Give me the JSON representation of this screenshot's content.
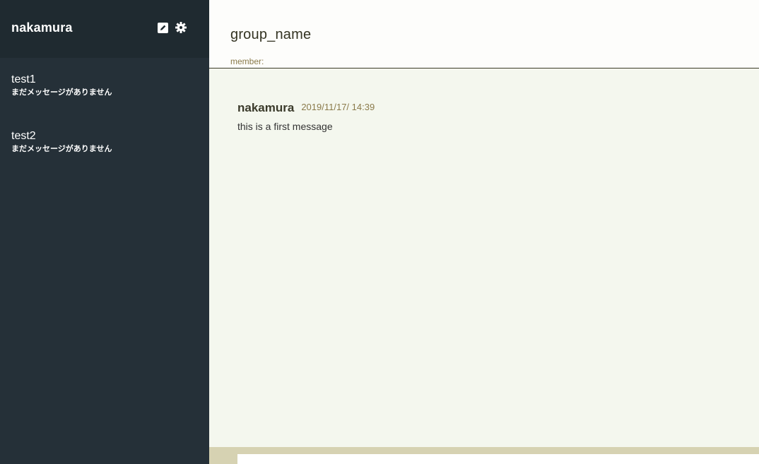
{
  "sidebar": {
    "user_name": "nakamura",
    "icons": {
      "edit": "edit-icon",
      "settings": "gear-icon"
    },
    "groups": [
      {
        "name": "test1",
        "last_message": "まだメッセージがありません"
      },
      {
        "name": "test2",
        "last_message": "まだメッセージがありません"
      }
    ]
  },
  "main": {
    "group_name": "group_name",
    "member_label": "member:",
    "messages": [
      {
        "author": "nakamura",
        "timestamp": "2019/11/17/ 14:39",
        "text": "this is a first message"
      }
    ],
    "input_value": ""
  },
  "colors": {
    "sidebar_bg": "#253038",
    "sidebar_header_bg": "#1f2a30",
    "main_bg": "#f4f7ee",
    "accent_text": "#8a7a4a",
    "form_bar": "#d6d2b2"
  }
}
